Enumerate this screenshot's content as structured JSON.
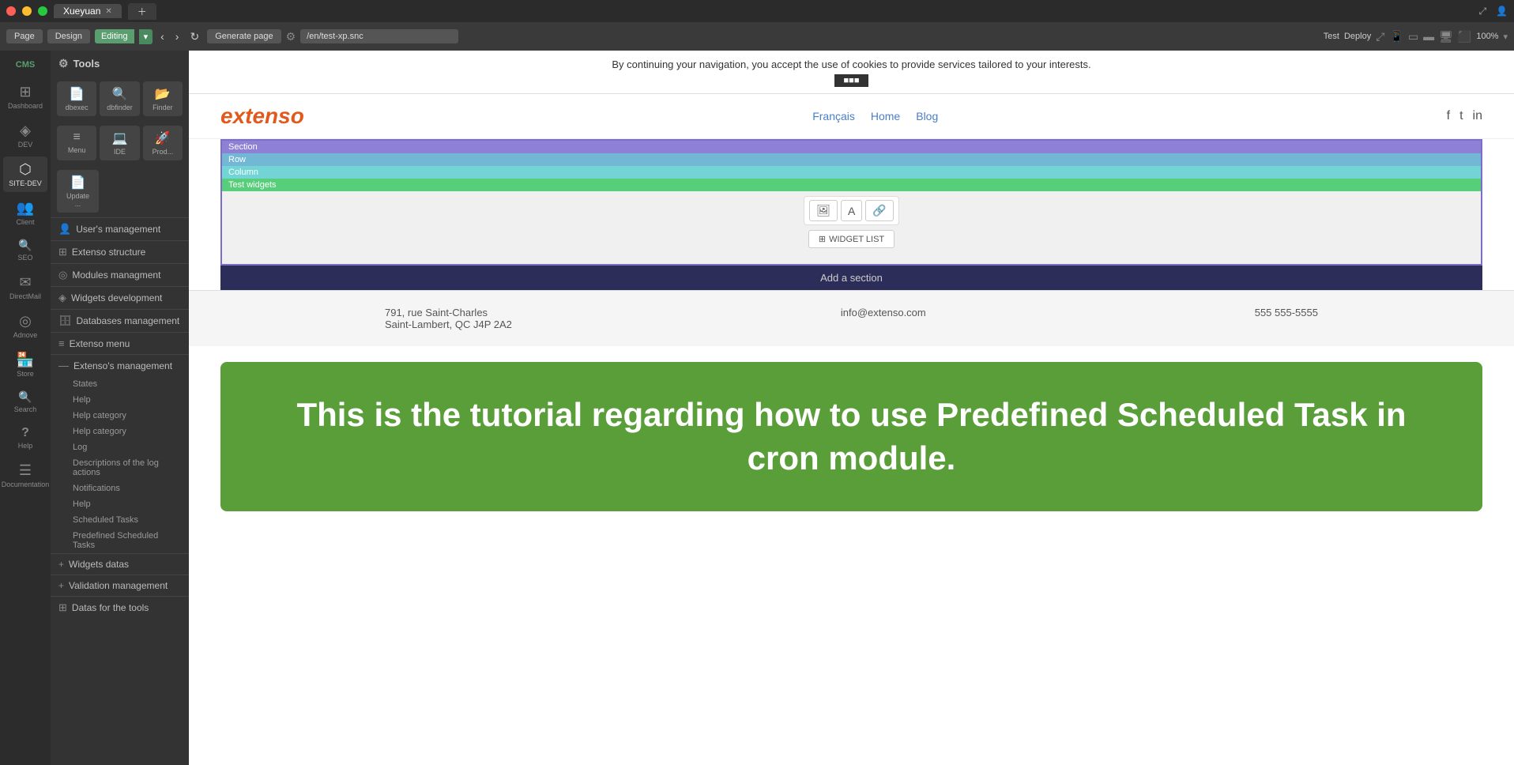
{
  "window": {
    "dots": [
      "red",
      "yellow",
      "green"
    ],
    "tabs": [
      {
        "label": "Xueyuan",
        "active": true
      },
      {
        "label": "",
        "active": false
      }
    ]
  },
  "toolbar": {
    "page_label": "Page",
    "design_label": "Design",
    "editing_label": "Editing",
    "generate_label": "Generate page",
    "url": "/en/test-xp.snc",
    "test_label": "Test",
    "deploy_label": "Deploy",
    "zoom": "100%"
  },
  "cms_sidebar": {
    "logo": "CMS",
    "items": [
      {
        "id": "dashboard",
        "label": "Dashboard",
        "icon": "⊞"
      },
      {
        "id": "dev",
        "label": "DEV",
        "icon": "◈"
      },
      {
        "id": "site-dev",
        "label": "SITE-DEV",
        "icon": "⬡"
      },
      {
        "id": "client",
        "label": "Client",
        "icon": "👥"
      },
      {
        "id": "seo",
        "label": "SEO",
        "icon": "🔍"
      },
      {
        "id": "directmail",
        "label": "DirectMail",
        "icon": "✉"
      },
      {
        "id": "adnove",
        "label": "Adnove",
        "icon": "◎"
      },
      {
        "id": "store",
        "label": "Store",
        "icon": "🏪"
      },
      {
        "id": "search",
        "label": "Search",
        "icon": "🔍"
      },
      {
        "id": "help",
        "label": "Help",
        "icon": "?"
      },
      {
        "id": "documentation",
        "label": "Documentation",
        "icon": "☰"
      }
    ]
  },
  "tools_panel": {
    "header": "Tools",
    "groups": [
      {
        "id": "users-mgmt",
        "label": "User's management",
        "icon": "👤"
      },
      {
        "id": "extenso-structure",
        "label": "Extenso structure",
        "icon": "⊞"
      },
      {
        "id": "modules-mgmt",
        "label": "Modules managment",
        "icon": "◎"
      },
      {
        "id": "widgets-dev",
        "label": "Widgets development",
        "icon": "◈"
      },
      {
        "id": "databases-mgmt",
        "label": "Databases management",
        "icon": "🗄"
      },
      {
        "id": "extenso-menu",
        "label": "Extenso menu",
        "icon": "≡"
      }
    ],
    "tool_icons": [
      {
        "id": "dbexec",
        "label": "dbexec",
        "icon": "📄"
      },
      {
        "id": "dbfinder",
        "label": "dbfinder",
        "icon": "🔍"
      },
      {
        "id": "finder",
        "label": "Finder",
        "icon": "📂"
      },
      {
        "id": "menu",
        "label": "Menu",
        "icon": "≡"
      },
      {
        "id": "ide",
        "label": "IDE",
        "icon": "💻"
      },
      {
        "id": "prod",
        "label": "Prod...",
        "icon": "🚀"
      },
      {
        "id": "update",
        "label": "Update ...",
        "icon": "📄"
      }
    ],
    "extenso_mgmt": {
      "label": "Extenso's management",
      "icon": "—",
      "items": [
        "States",
        "Help",
        "Help category",
        "Help category",
        "Log",
        "Descriptions of the log actions",
        "Notifications",
        "Help",
        "Scheduled Tasks",
        "Predefined Scheduled Tasks"
      ]
    },
    "widgets_datas": {
      "label": "Widgets datas",
      "icon": "+"
    },
    "validation_mgmt": {
      "label": "Validation management",
      "icon": "+"
    },
    "datas_for_tools": {
      "label": "Datas for the tools",
      "icon": "⊞"
    }
  },
  "page": {
    "cookie_bar": "By continuing your navigation, you accept the use of cookies to provide services tailored to your interests.",
    "header": {
      "logo": "extenso",
      "nav": [
        "Français",
        "Home",
        "Blog"
      ],
      "social": [
        "f",
        "t",
        "in"
      ]
    },
    "section_labels": {
      "section": "Section",
      "row": "Row",
      "column": "Column",
      "widget": "Test widgets"
    },
    "widget_buttons": [
      "🖼",
      "A",
      "🔗"
    ],
    "widget_list_label": "WIDGET LIST",
    "add_section": "Add a section",
    "footer": {
      "address_line1": "791, rue Saint-Charles",
      "address_line2": "Saint-Lambert, QC J4P 2A2",
      "email": "info@extenso.com",
      "phone": "555 555-5555"
    },
    "tutorial": {
      "text": "This is the tutorial regarding how to use Predefined Scheduled Task in cron module."
    }
  }
}
